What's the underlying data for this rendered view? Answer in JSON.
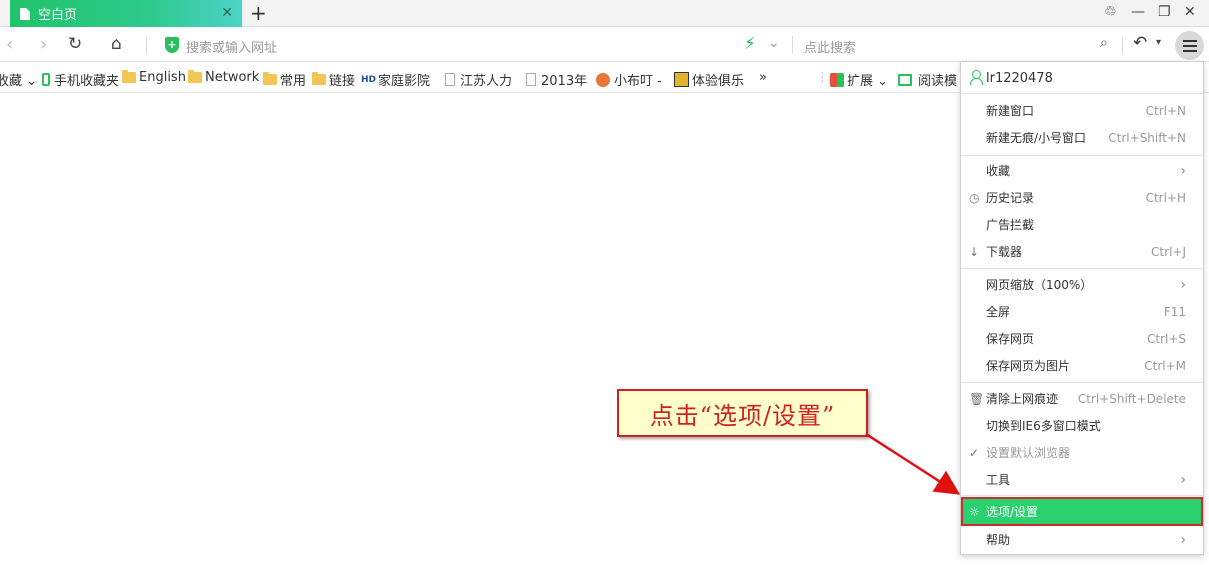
{
  "tab": {
    "title": "空白页",
    "close": "✕"
  },
  "titlebar": {
    "new_tab": "+",
    "skin": "♲",
    "minimize": "—",
    "restore": "❐",
    "close": "✕"
  },
  "address": {
    "placeholder": "搜索或输入网址",
    "search_placeholder": "点此搜索"
  },
  "bookmarks": [
    {
      "label": "收藏 ⌄",
      "icon": "none"
    },
    {
      "label": "手机收藏夹",
      "icon": "phone-icon"
    },
    {
      "label": "English",
      "icon": "folder-icon"
    },
    {
      "label": "Network",
      "icon": "folder-icon"
    },
    {
      "label": "常用",
      "icon": "folder-icon"
    },
    {
      "label": "链接",
      "icon": "folder-icon"
    },
    {
      "label": "家庭影院",
      "icon": "hd-icon"
    },
    {
      "label": "江苏人力",
      "icon": "page-icon"
    },
    {
      "label": "2013年",
      "icon": "page-icon"
    },
    {
      "label": "小布叮 -",
      "icon": "mascot-icon"
    },
    {
      "label": "体验俱乐",
      "icon": "tiger-icon"
    }
  ],
  "bookmarks_more": "»",
  "bookmarks_right": {
    "extensions": "扩展 ⌄",
    "reading": "阅读模"
  },
  "menu": {
    "user": "lr1220478",
    "items": [
      {
        "label": "新建窗口",
        "shortcut": "Ctrl+N"
      },
      {
        "label": "新建无痕/小号窗口",
        "shortcut": "Ctrl+Shift+N"
      },
      {
        "label": "收藏",
        "shortcut": ""
      },
      {
        "label": "历史记录",
        "shortcut": "Ctrl+H"
      },
      {
        "label": "广告拦截",
        "shortcut": ""
      },
      {
        "label": "下载器",
        "shortcut": "Ctrl+J"
      },
      {
        "label": "网页缩放（100%）",
        "shortcut": ""
      },
      {
        "label": "全屏",
        "shortcut": "F11"
      },
      {
        "label": "保存网页",
        "shortcut": "Ctrl+S"
      },
      {
        "label": "保存网页为图片",
        "shortcut": "Ctrl+M"
      },
      {
        "label": "清除上网痕迹",
        "shortcut": "Ctrl+Shift+Delete"
      },
      {
        "label": "切换到IE6多窗口模式",
        "shortcut": ""
      },
      {
        "label": "设置默认浏览器",
        "shortcut": ""
      },
      {
        "label": "工具",
        "shortcut": ""
      },
      {
        "label": "选项/设置",
        "shortcut": ""
      },
      {
        "label": "帮助",
        "shortcut": ""
      }
    ]
  },
  "callout": {
    "text": "点击“选项/设置”"
  },
  "colors": {
    "accent": "#2bd16f",
    "callout_red": "#d02020",
    "callout_bg": "#ffffcc"
  }
}
